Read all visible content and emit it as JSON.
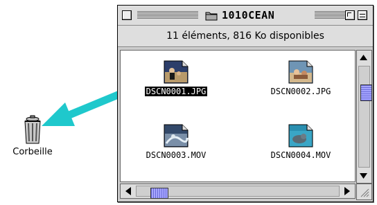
{
  "window": {
    "title": "1010CEAN",
    "info": "11 éléments, 816  Ko disponibles"
  },
  "files": [
    {
      "name": "DSCN0001.JPG",
      "selected": true
    },
    {
      "name": "DSCN0002.JPG",
      "selected": false
    },
    {
      "name": "DSCN0003.MOV",
      "selected": false
    },
    {
      "name": "DSCN0004.MOV",
      "selected": false
    }
  ],
  "desktop": {
    "trash_label": "Corbeille"
  },
  "colors": {
    "drag_arrow": "#1fc8cc",
    "scroll_thumb": "#a6a6ff",
    "selection": "#000000"
  },
  "icons": {
    "folder": "folder-icon",
    "trash": "trash-icon",
    "jpg": "jpeg-thumbnail-icon",
    "mov": "movie-thumbnail-icon"
  }
}
